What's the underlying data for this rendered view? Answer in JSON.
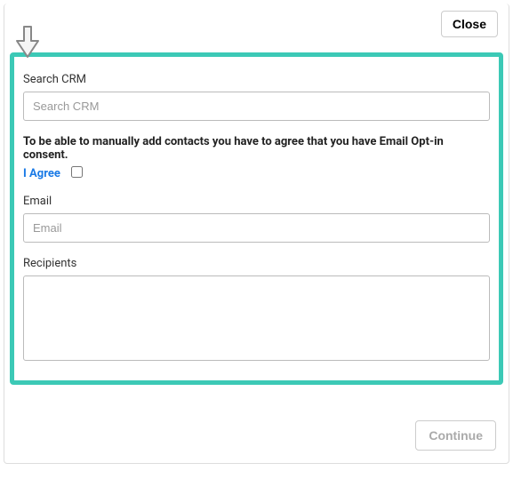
{
  "header": {
    "close_label": "Close"
  },
  "form": {
    "search_crm_label": "Search CRM",
    "search_crm_placeholder": "Search CRM",
    "consent_text": "To be able to manually add contacts you have to agree that you have Email Opt-in consent.",
    "agree_label": "I Agree",
    "email_label": "Email",
    "email_placeholder": "Email",
    "recipients_label": "Recipients"
  },
  "footer": {
    "continue_label": "Continue"
  }
}
